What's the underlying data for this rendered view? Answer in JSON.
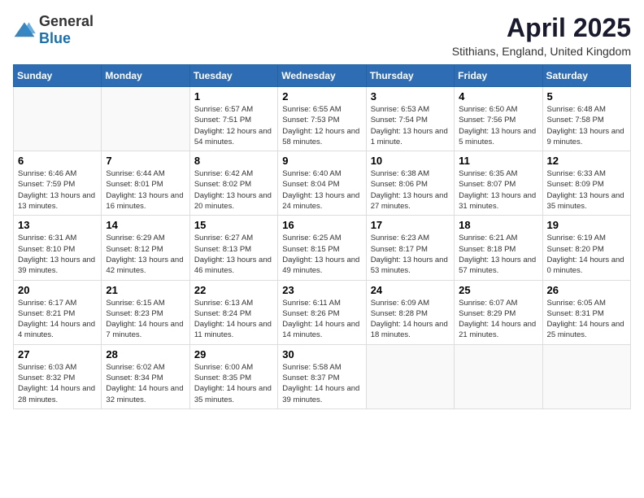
{
  "header": {
    "logo": {
      "general": "General",
      "blue": "Blue"
    },
    "title": "April 2025",
    "subtitle": "Stithians, England, United Kingdom"
  },
  "weekdays": [
    "Sunday",
    "Monday",
    "Tuesday",
    "Wednesday",
    "Thursday",
    "Friday",
    "Saturday"
  ],
  "weeks": [
    [
      {
        "day": "",
        "info": ""
      },
      {
        "day": "",
        "info": ""
      },
      {
        "day": "1",
        "info": "Sunrise: 6:57 AM\nSunset: 7:51 PM\nDaylight: 12 hours and 54 minutes."
      },
      {
        "day": "2",
        "info": "Sunrise: 6:55 AM\nSunset: 7:53 PM\nDaylight: 12 hours and 58 minutes."
      },
      {
        "day": "3",
        "info": "Sunrise: 6:53 AM\nSunset: 7:54 PM\nDaylight: 13 hours and 1 minute."
      },
      {
        "day": "4",
        "info": "Sunrise: 6:50 AM\nSunset: 7:56 PM\nDaylight: 13 hours and 5 minutes."
      },
      {
        "day": "5",
        "info": "Sunrise: 6:48 AM\nSunset: 7:58 PM\nDaylight: 13 hours and 9 minutes."
      }
    ],
    [
      {
        "day": "6",
        "info": "Sunrise: 6:46 AM\nSunset: 7:59 PM\nDaylight: 13 hours and 13 minutes."
      },
      {
        "day": "7",
        "info": "Sunrise: 6:44 AM\nSunset: 8:01 PM\nDaylight: 13 hours and 16 minutes."
      },
      {
        "day": "8",
        "info": "Sunrise: 6:42 AM\nSunset: 8:02 PM\nDaylight: 13 hours and 20 minutes."
      },
      {
        "day": "9",
        "info": "Sunrise: 6:40 AM\nSunset: 8:04 PM\nDaylight: 13 hours and 24 minutes."
      },
      {
        "day": "10",
        "info": "Sunrise: 6:38 AM\nSunset: 8:06 PM\nDaylight: 13 hours and 27 minutes."
      },
      {
        "day": "11",
        "info": "Sunrise: 6:35 AM\nSunset: 8:07 PM\nDaylight: 13 hours and 31 minutes."
      },
      {
        "day": "12",
        "info": "Sunrise: 6:33 AM\nSunset: 8:09 PM\nDaylight: 13 hours and 35 minutes."
      }
    ],
    [
      {
        "day": "13",
        "info": "Sunrise: 6:31 AM\nSunset: 8:10 PM\nDaylight: 13 hours and 39 minutes."
      },
      {
        "day": "14",
        "info": "Sunrise: 6:29 AM\nSunset: 8:12 PM\nDaylight: 13 hours and 42 minutes."
      },
      {
        "day": "15",
        "info": "Sunrise: 6:27 AM\nSunset: 8:13 PM\nDaylight: 13 hours and 46 minutes."
      },
      {
        "day": "16",
        "info": "Sunrise: 6:25 AM\nSunset: 8:15 PM\nDaylight: 13 hours and 49 minutes."
      },
      {
        "day": "17",
        "info": "Sunrise: 6:23 AM\nSunset: 8:17 PM\nDaylight: 13 hours and 53 minutes."
      },
      {
        "day": "18",
        "info": "Sunrise: 6:21 AM\nSunset: 8:18 PM\nDaylight: 13 hours and 57 minutes."
      },
      {
        "day": "19",
        "info": "Sunrise: 6:19 AM\nSunset: 8:20 PM\nDaylight: 14 hours and 0 minutes."
      }
    ],
    [
      {
        "day": "20",
        "info": "Sunrise: 6:17 AM\nSunset: 8:21 PM\nDaylight: 14 hours and 4 minutes."
      },
      {
        "day": "21",
        "info": "Sunrise: 6:15 AM\nSunset: 8:23 PM\nDaylight: 14 hours and 7 minutes."
      },
      {
        "day": "22",
        "info": "Sunrise: 6:13 AM\nSunset: 8:24 PM\nDaylight: 14 hours and 11 minutes."
      },
      {
        "day": "23",
        "info": "Sunrise: 6:11 AM\nSunset: 8:26 PM\nDaylight: 14 hours and 14 minutes."
      },
      {
        "day": "24",
        "info": "Sunrise: 6:09 AM\nSunset: 8:28 PM\nDaylight: 14 hours and 18 minutes."
      },
      {
        "day": "25",
        "info": "Sunrise: 6:07 AM\nSunset: 8:29 PM\nDaylight: 14 hours and 21 minutes."
      },
      {
        "day": "26",
        "info": "Sunrise: 6:05 AM\nSunset: 8:31 PM\nDaylight: 14 hours and 25 minutes."
      }
    ],
    [
      {
        "day": "27",
        "info": "Sunrise: 6:03 AM\nSunset: 8:32 PM\nDaylight: 14 hours and 28 minutes."
      },
      {
        "day": "28",
        "info": "Sunrise: 6:02 AM\nSunset: 8:34 PM\nDaylight: 14 hours and 32 minutes."
      },
      {
        "day": "29",
        "info": "Sunrise: 6:00 AM\nSunset: 8:35 PM\nDaylight: 14 hours and 35 minutes."
      },
      {
        "day": "30",
        "info": "Sunrise: 5:58 AM\nSunset: 8:37 PM\nDaylight: 14 hours and 39 minutes."
      },
      {
        "day": "",
        "info": ""
      },
      {
        "day": "",
        "info": ""
      },
      {
        "day": "",
        "info": ""
      }
    ]
  ]
}
